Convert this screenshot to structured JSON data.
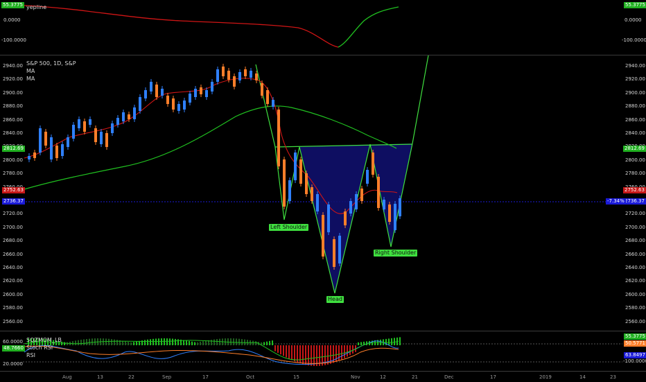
{
  "top_pane": {
    "title": "yepline",
    "left_ticks": [
      "0.0000",
      "-100.0000"
    ],
    "right_ticks": [
      "0.0000",
      "-100.0000"
    ],
    "left_value_tag": "55.3775",
    "right_value_tag": "55.3775"
  },
  "main_pane": {
    "title": "S&P 500, 1D, S&P",
    "ma_labels": [
      "MA",
      "MA"
    ],
    "price_ticks": [
      "2940.00",
      "2920.00",
      "2900.00",
      "2880.00",
      "2860.00",
      "2840.00",
      "2820.00",
      "2800.00",
      "2780.00",
      "2760.00",
      "2740.00",
      "2720.00",
      "2700.00",
      "2680.00",
      "2660.00",
      "2640.00",
      "2620.00",
      "2600.00",
      "2580.00",
      "2560.00"
    ],
    "tags": {
      "left_green": "2812.69",
      "left_red": "2752.63",
      "left_blue": "2736.37",
      "right_green": "2812.69",
      "right_red": "2752.63",
      "right_blue": "2736.37",
      "right_change": "-7.34%"
    },
    "annotations": {
      "left_shoulder": "Left Shoulder",
      "head": "Head",
      "right_shoulder": "Right Shoulder"
    }
  },
  "bottom_pane": {
    "labels": [
      "SQZMOM_LB",
      "Stoch RSI",
      "RSI"
    ],
    "left_ticks": [
      "60.0000",
      "20.0000"
    ],
    "left_tags": [
      "48.7660"
    ],
    "right_tags": [
      "55.3775",
      "50.5771",
      "63.8497",
      "-100.0000"
    ]
  },
  "time_axis": {
    "labels": [
      "Aug",
      "13",
      "22",
      "Sep",
      "17",
      "Oct",
      "15",
      "Nov",
      "12",
      "21",
      "Dec",
      "17",
      "2019",
      "14",
      "23"
    ]
  },
  "colors": {
    "background": "#000000",
    "bull_candle": "#2f80ff",
    "bear_candle": "#ff7f2a",
    "ma_fast": "#d01515",
    "ma_slow": "#20c020",
    "pattern_fill": "#10106b",
    "pattern_line": "#3fe03f",
    "tag_green": "#20b020",
    "tag_red": "#c81818",
    "tag_blue": "#1a1ad8"
  }
}
